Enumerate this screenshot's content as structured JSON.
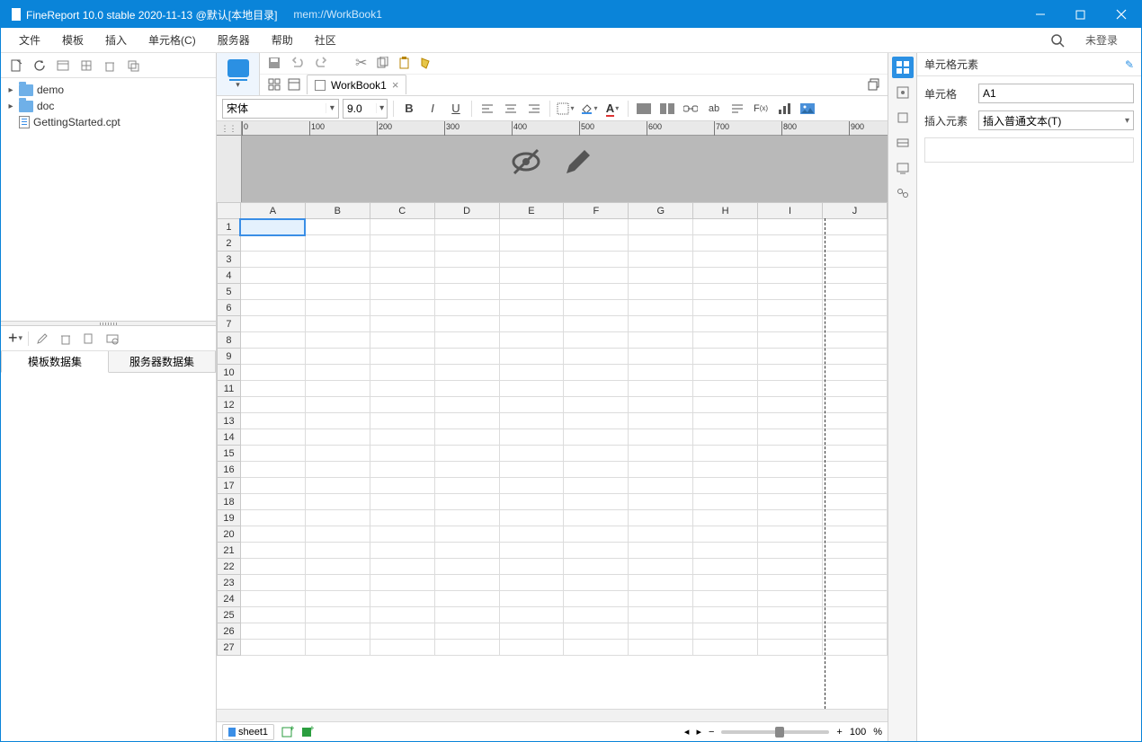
{
  "titlebar": {
    "title": "FineReport 10.0 stable 2020-11-13 @默认[本地目录]",
    "filepath": "mem://WorkBook1"
  },
  "menu": {
    "items": [
      "文件",
      "模板",
      "插入",
      "单元格(C)",
      "服务器",
      "帮助",
      "社区"
    ],
    "login": "未登录"
  },
  "tree": {
    "nodes": [
      {
        "type": "folder",
        "label": "demo"
      },
      {
        "type": "folder",
        "label": "doc"
      },
      {
        "type": "file",
        "label": "GettingStarted.cpt"
      }
    ]
  },
  "dataset": {
    "tabs": [
      "模板数据集",
      "服务器数据集"
    ],
    "active": 0
  },
  "workbook": {
    "tab_label": "WorkBook1",
    "font": "宋体",
    "fontsize": "9.0",
    "columns": [
      "A",
      "B",
      "C",
      "D",
      "E",
      "F",
      "G",
      "H",
      "I",
      "J"
    ],
    "row_count": 27,
    "selected": "A1",
    "ruler_ticks": [
      0,
      100,
      200,
      300,
      400,
      500,
      600,
      700,
      800,
      900
    ]
  },
  "status": {
    "sheet": "sheet1",
    "zoom": "100",
    "zoom_unit": "%"
  },
  "rightpanel": {
    "title": "单元格元素",
    "cell_label": "单元格",
    "cell_value": "A1",
    "insert_label": "插入元素",
    "insert_value": "插入普通文本(T)"
  }
}
